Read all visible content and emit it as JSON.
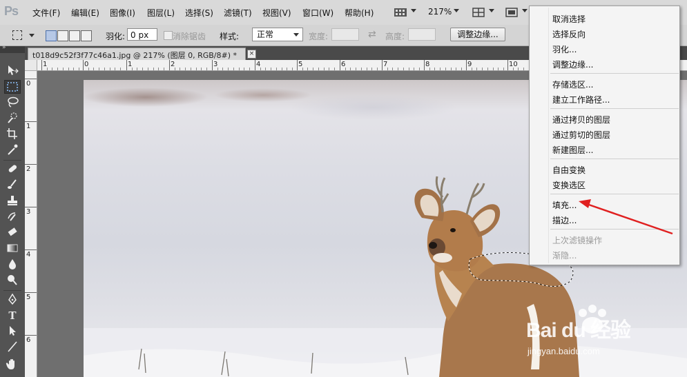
{
  "app": {
    "logo": "Ps"
  },
  "menubar": {
    "items": [
      "文件(F)",
      "编辑(E)",
      "图像(I)",
      "图层(L)",
      "选择(S)",
      "滤镜(T)",
      "视图(V)",
      "窗口(W)",
      "帮助(H)"
    ],
    "zoom": "217%"
  },
  "options": {
    "feather_label": "羽化:",
    "feather_value": "0 px",
    "antialias_label": "消除锯齿",
    "style_label": "样式:",
    "style_value": "正常",
    "width_label": "宽度:",
    "height_label": "高度:",
    "refine_edge_button": "调整边缘..."
  },
  "document": {
    "tab_title": "t018d9c52f3f77c46a1.jpg @ 217% (图层 0, RGB/8#) *",
    "close_glyph": "×"
  },
  "ruler": {
    "top_labels": [
      "1",
      "0",
      "1",
      "2",
      "3",
      "4",
      "5",
      "6",
      "7",
      "8",
      "9",
      "10"
    ],
    "left_labels": [
      "0",
      "1",
      "2",
      "3",
      "4",
      "5",
      "6"
    ]
  },
  "context_menu": {
    "items": [
      {
        "label": "取消选择",
        "enabled": true
      },
      {
        "label": "选择反向",
        "enabled": true
      },
      {
        "label": "羽化...",
        "enabled": true
      },
      {
        "label": "调整边缘...",
        "enabled": true
      },
      {
        "label": "存储选区...",
        "enabled": true
      },
      {
        "label": "建立工作路径...",
        "enabled": true
      },
      {
        "label": "通过拷贝的图层",
        "enabled": true
      },
      {
        "label": "通过剪切的图层",
        "enabled": true
      },
      {
        "label": "新建图层...",
        "enabled": true
      },
      {
        "label": "自由变换",
        "enabled": true
      },
      {
        "label": "变换选区",
        "enabled": true
      },
      {
        "label": "填充...",
        "enabled": true
      },
      {
        "label": "描边...",
        "enabled": true
      },
      {
        "label": "上次滤镜操作",
        "enabled": false
      },
      {
        "label": "渐隐...",
        "enabled": false
      }
    ]
  },
  "watermark": {
    "brand": "Bai du 经验",
    "url": "jingyan.baidu.com"
  },
  "colors": {
    "annotation_arrow": "#e02020",
    "menubar_bg": "#d9d9d9",
    "toolpanel_bg": "#535353"
  }
}
